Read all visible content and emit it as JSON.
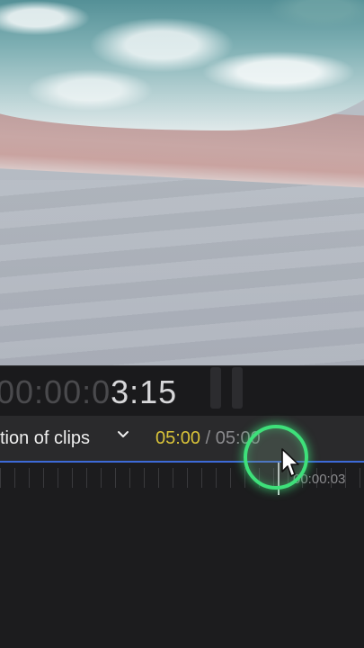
{
  "viewer": {
    "timecode_dim": "00:00:0",
    "timecode_bright": "3:15"
  },
  "clip_header": {
    "title": "tion of clips",
    "chevron_icon": "chevron-down-icon",
    "duration_current": "05:00",
    "duration_separator": " / ",
    "duration_total": "05:00"
  },
  "timeline": {
    "ruler_label": "00:00:03"
  },
  "colors": {
    "duration_accent": "#d9c339",
    "click_highlight": "#3ee07a",
    "timeline_line": "#3d6ad8"
  }
}
